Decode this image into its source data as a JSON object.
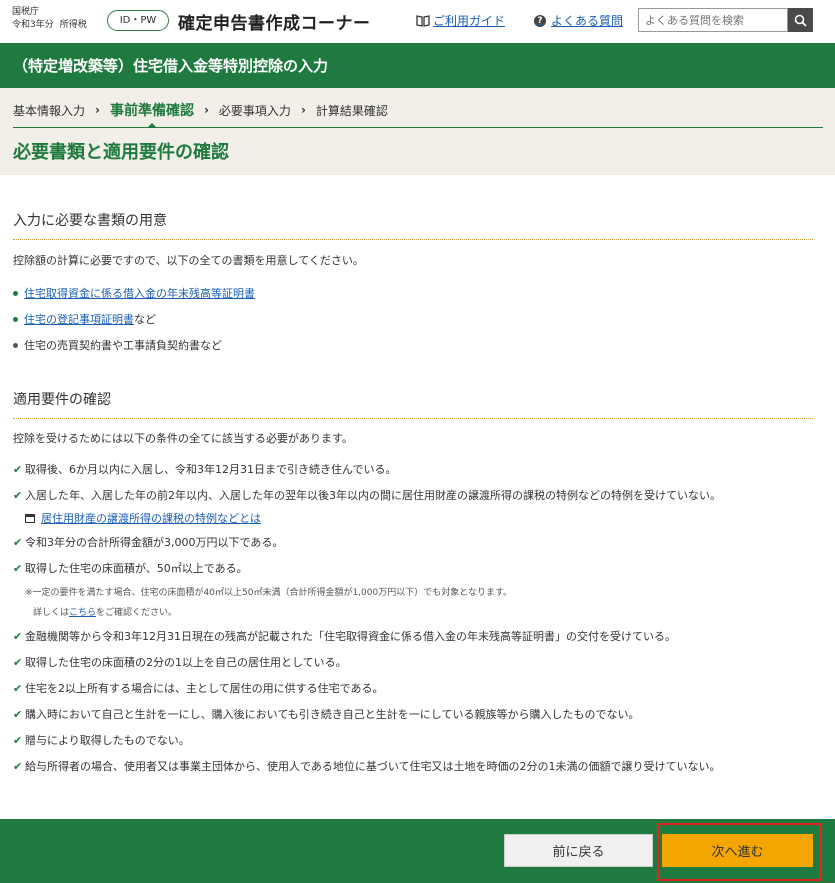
{
  "header": {
    "agency": "国税庁",
    "year": "令和3年分",
    "tax": "所得税",
    "idpw": "ID・PW",
    "app_title": "確定申告書作成コーナー",
    "guide_label": "ご利用ガイド",
    "faq_label": "よくある質問",
    "search_placeholder": "よくある質問を検索"
  },
  "band": {
    "title": "（特定増改築等）住宅借入金等特別控除の入力"
  },
  "steps": [
    {
      "label": "基本情報入力"
    },
    {
      "label": "事前準備確認"
    },
    {
      "label": "必要事項入力"
    },
    {
      "label": "計算結果確認"
    }
  ],
  "page_title": "必要書類と適用要件の確認",
  "docs": {
    "title": "入力に必要な書類の用意",
    "intro": "控除額の計算に必要ですので、以下の全ての書類を用意してください。",
    "items": [
      {
        "link": "住宅取得資金に係る借入金の年末残高等証明書",
        "suffix": ""
      },
      {
        "link": "住宅の登記事項証明書",
        "suffix": "など"
      },
      {
        "link": "",
        "suffix": "住宅の売買契約書や工事請負契約書など"
      }
    ]
  },
  "reqs": {
    "title": "適用要件の確認",
    "intro": "控除を受けるためには以下の条件の全てに該当する必要があります。",
    "items": [
      "取得後、6か月以内に入居し、令和3年12月31日まで引き続き住んでいる。",
      "入居した年、入居した年の前2年以内、入居した年の翌年以後3年以内の間に居住用財産の譲渡所得の課税の特例などの特例を受けていない。",
      "令和3年分の合計所得金額が3,000万円以下である。",
      "取得した住宅の床面積が、50㎡以上である。",
      "金融機関等から令和3年12月31日現在の残高が記載された「住宅取得資金に係る借入金の年末残高等証明書」の交付を受けている。",
      "取得した住宅の床面積の2分の1以上を自己の居住用としている。",
      "住宅を2以上所有する場合には、主として居住の用に供する住宅である。",
      "購入時において自己と生計を一にし、購入後においても引き続き自己と生計を一にしている親族等から購入したものでない。",
      "贈与により取得したものでない。",
      "給与所得者の場合、使用者又は事業主団体から、使用人である地位に基づいて住宅又は土地を時価の2分の1未満の価額で譲り受けていない。"
    ],
    "special_link": "居住用財産の譲渡所得の課税の特例などとは",
    "note1": "※一定の要件を満たす場合、住宅の床面積が40㎡以上50㎡未満（合計所得金額が1,000万円以下）でも対象となります。",
    "note2_pre": "詳しくは",
    "note2_link": "こちら",
    "note2_post": "をご確認ください。"
  },
  "footer": {
    "back_label": "前に戻る",
    "next_label": "次へ進む"
  }
}
